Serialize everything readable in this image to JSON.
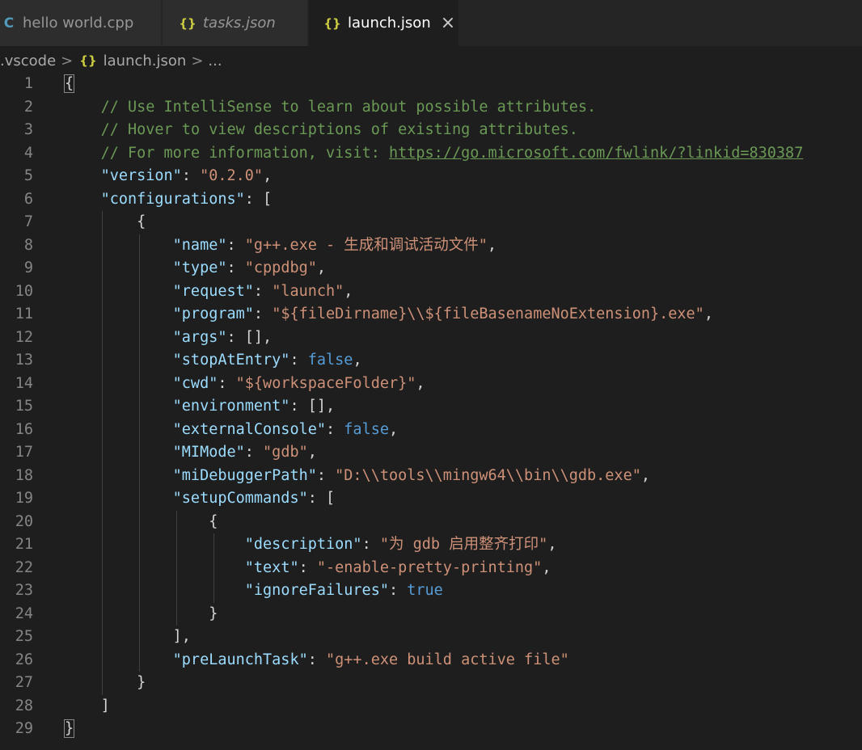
{
  "tabs": [
    {
      "label": "hello world.cpp",
      "icon": "cpp-file-icon",
      "active": false,
      "italic": false
    },
    {
      "label": "tasks.json",
      "icon": "json-file-icon",
      "active": false,
      "italic": true
    },
    {
      "label": "launch.json",
      "icon": "json-file-icon",
      "active": true,
      "italic": false,
      "close": "×"
    }
  ],
  "breadcrumb": {
    "folder": ".vscode",
    "file": "launch.json",
    "ellipsis": "..."
  },
  "editor": {
    "line_numbers": [
      "1",
      "2",
      "3",
      "4",
      "5",
      "6",
      "7",
      "8",
      "9",
      "10",
      "11",
      "12",
      "13",
      "14",
      "15",
      "16",
      "17",
      "18",
      "19",
      "20",
      "21",
      "22",
      "23",
      "24",
      "25",
      "26",
      "27",
      "28",
      "29"
    ],
    "comments": {
      "c1": "// Use IntelliSense to learn about possible attributes.",
      "c2": "// Hover to view descriptions of existing attributes.",
      "c3": "// For more information, visit: ",
      "link": "https://go.microsoft.com/fwlink/?linkid=830387"
    },
    "keys": {
      "version": "\"version\"",
      "configurations": "\"configurations\"",
      "name": "\"name\"",
      "type": "\"type\"",
      "request": "\"request\"",
      "program": "\"program\"",
      "args": "\"args\"",
      "stopAtEntry": "\"stopAtEntry\"",
      "cwd": "\"cwd\"",
      "environment": "\"environment\"",
      "externalConsole": "\"externalConsole\"",
      "MIMode": "\"MIMode\"",
      "miDebuggerPath": "\"miDebuggerPath\"",
      "setupCommands": "\"setupCommands\"",
      "description": "\"description\"",
      "text": "\"text\"",
      "ignoreFailures": "\"ignoreFailures\"",
      "preLaunchTask": "\"preLaunchTask\""
    },
    "values": {
      "version": "\"0.2.0\"",
      "name": "\"g++.exe - 生成和调试活动文件\"",
      "type": "\"cppdbg\"",
      "request": "\"launch\"",
      "program": "\"${fileDirname}\\\\${fileBasenameNoExtension}.exe\"",
      "stopAtEntry": "false",
      "cwd": "\"${workspaceFolder}\"",
      "externalConsole": "false",
      "MIMode": "\"gdb\"",
      "miDebuggerPath": "\"D:\\\\tools\\\\mingw64\\\\bin\\\\gdb.exe\"",
      "description": "\"为 gdb 启用整齐打印\"",
      "text": "\"-enable-pretty-printing\"",
      "ignoreFailures": "true",
      "preLaunchTask": "\"g++.exe build active file\""
    }
  },
  "colors": {
    "background": "#1e1e1e",
    "comment": "#6a9955",
    "key": "#9cdcfe",
    "string": "#ce9178",
    "keyword": "#569cd6",
    "line_number": "#858585"
  }
}
